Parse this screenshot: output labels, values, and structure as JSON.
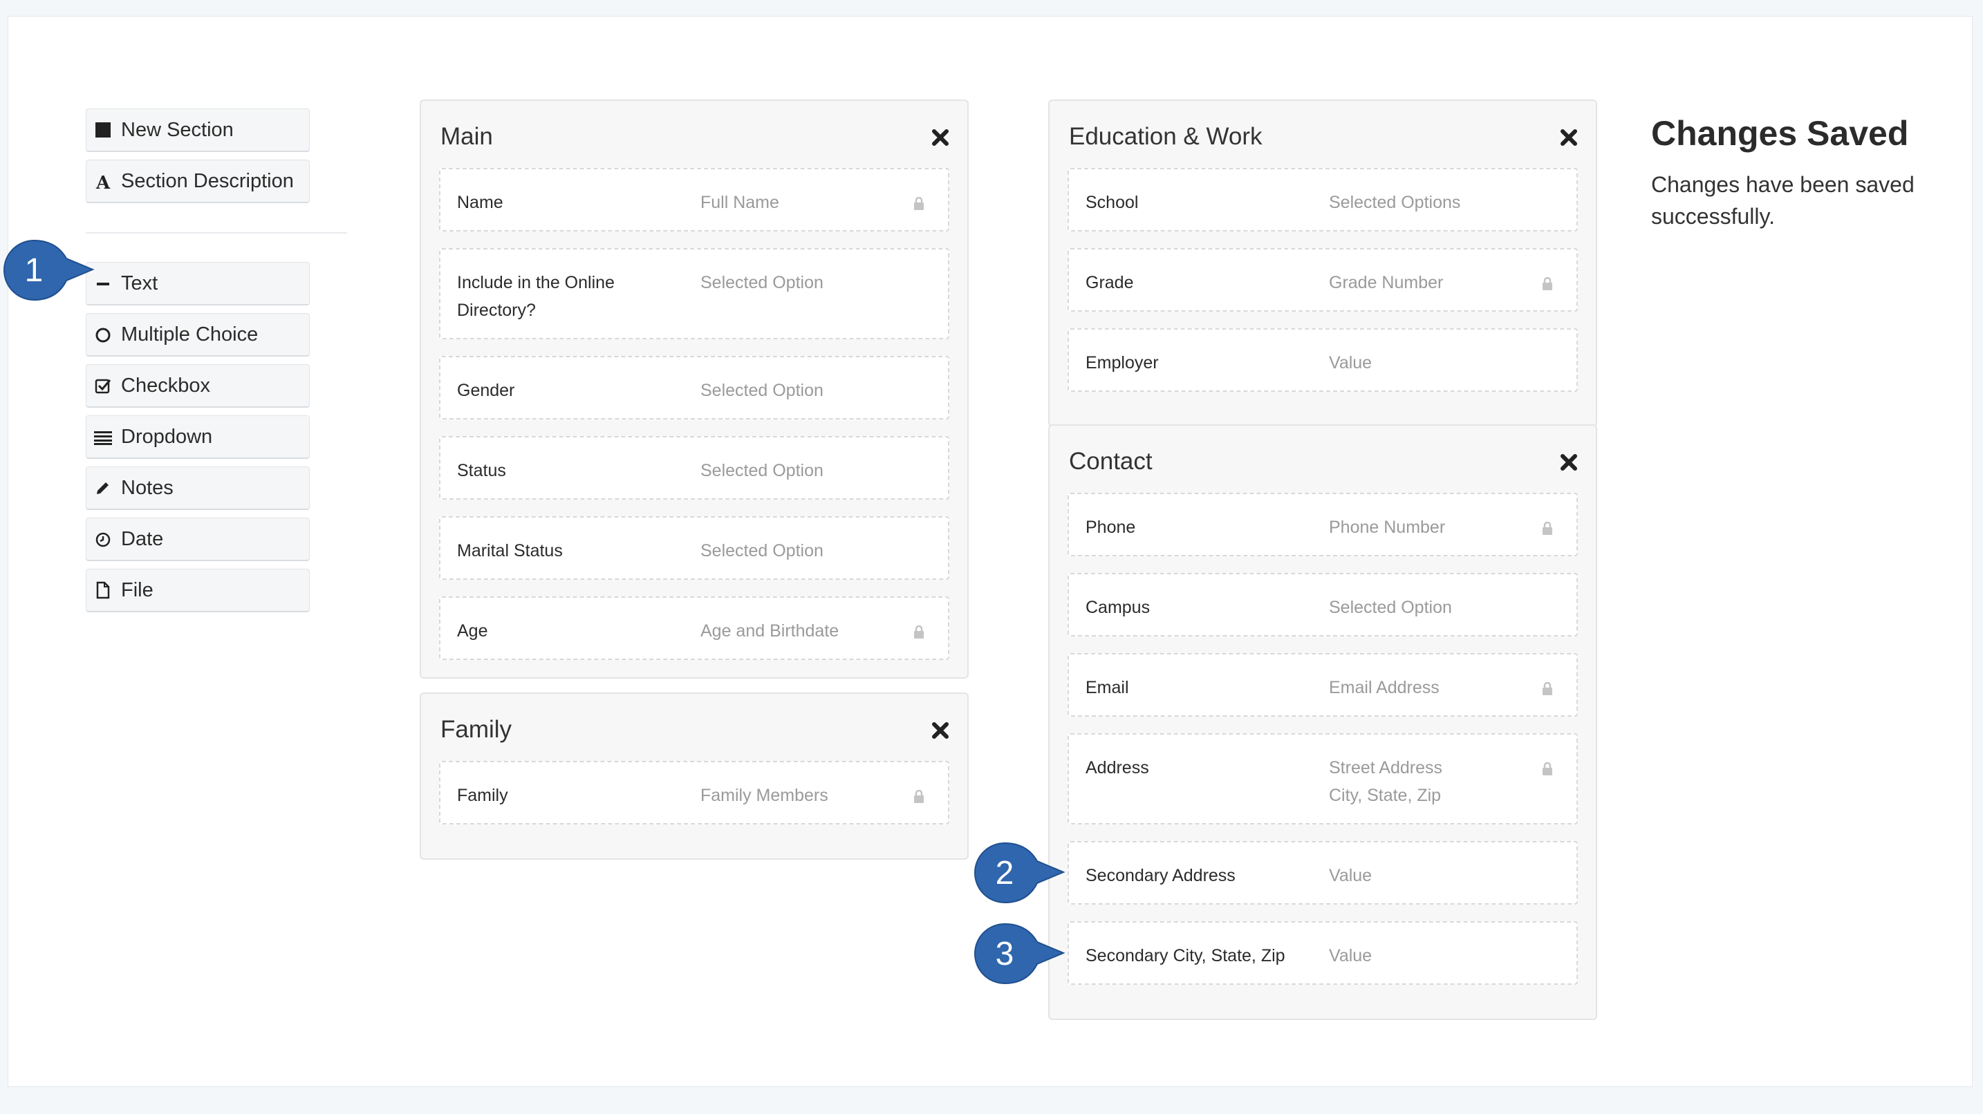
{
  "toolbox": {
    "layout_items": [
      {
        "label": "New Section",
        "icon": "square-icon"
      },
      {
        "label": "Section Description",
        "icon": "letter-a-icon"
      }
    ],
    "field_items": [
      {
        "label": "Text",
        "icon": "dash-icon"
      },
      {
        "label": "Multiple Choice",
        "icon": "circle-icon"
      },
      {
        "label": "Checkbox",
        "icon": "checkbox-icon"
      },
      {
        "label": "Dropdown",
        "icon": "list-icon"
      },
      {
        "label": "Notes",
        "icon": "pencil-icon"
      },
      {
        "label": "Date",
        "icon": "clock-icon"
      },
      {
        "label": "File",
        "icon": "file-icon"
      }
    ]
  },
  "sections": {
    "main": {
      "title": "Main",
      "fields": [
        {
          "label": "Name",
          "hint": "Full Name",
          "locked": true
        },
        {
          "label": "Include in the Online Directory?",
          "hint": "Selected Option",
          "locked": false
        },
        {
          "label": "Gender",
          "hint": "Selected Option",
          "locked": false
        },
        {
          "label": "Status",
          "hint": "Selected Option",
          "locked": false
        },
        {
          "label": "Marital Status",
          "hint": "Selected Option",
          "locked": false
        },
        {
          "label": "Age",
          "hint": "Age and Birthdate",
          "locked": true
        }
      ]
    },
    "family": {
      "title": "Family",
      "fields": [
        {
          "label": "Family",
          "hint": "Family Members",
          "locked": true
        }
      ]
    },
    "education": {
      "title": "Education & Work",
      "fields": [
        {
          "label": "School",
          "hint": "Selected Options",
          "locked": false
        },
        {
          "label": "Grade",
          "hint": "Grade Number",
          "locked": true
        },
        {
          "label": "Employer",
          "hint": "Value",
          "locked": false
        }
      ]
    },
    "contact": {
      "title": "Contact",
      "fields": [
        {
          "label": "Phone",
          "hint": "Phone Number",
          "locked": true
        },
        {
          "label": "Campus",
          "hint": "Selected Option",
          "locked": false
        },
        {
          "label": "Email",
          "hint": "Email Address",
          "locked": true
        },
        {
          "label": "Address",
          "hint": "Street Address\nCity, State, Zip",
          "locked": true
        },
        {
          "label": "Secondary Address",
          "hint": "Value",
          "locked": false
        },
        {
          "label": "Secondary City, State, Zip",
          "hint": "Value",
          "locked": false
        }
      ]
    }
  },
  "status": {
    "title": "Changes Saved",
    "message": "Changes have been saved successfully."
  },
  "markers": [
    "1",
    "2",
    "3"
  ],
  "colors": {
    "marker": "#2f66ad",
    "page_background": "#f4f7fa",
    "card_background": "#f7f7f7"
  }
}
